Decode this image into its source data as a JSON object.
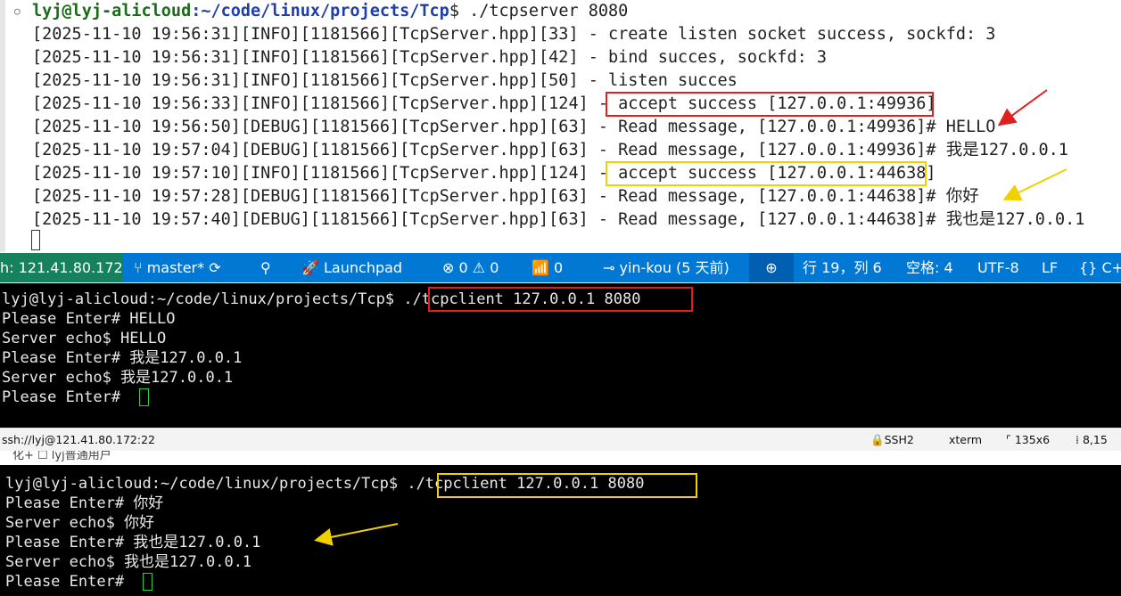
{
  "top_terminal": {
    "prompt_user": "lyj@lyj-alicloud",
    "prompt_path": ":~/code/linux/projects/Tcp",
    "prompt_cmd": "$ ./tcpserver 8080",
    "log_lines": [
      "[2025-11-10 19:56:31][INFO][1181566][TcpServer.hpp][33] - create listen socket success, sockfd: 3",
      "[2025-11-10 19:56:31][INFO][1181566][TcpServer.hpp][42] - bind succes, sockfd: 3",
      "[2025-11-10 19:56:31][INFO][1181566][TcpServer.hpp][50] - listen succes",
      "[2025-11-10 19:56:33][INFO][1181566][TcpServer.hpp][124] - accept success [127.0.0.1:49936]",
      "[2025-11-10 19:56:50][DEBUG][1181566][TcpServer.hpp][63] - Read message, [127.0.0.1:49936]# HELLO",
      "[2025-11-10 19:57:04][DEBUG][1181566][TcpServer.hpp][63] - Read message, [127.0.0.1:49936]# 我是127.0.0.1",
      "[2025-11-10 19:57:10][INFO][1181566][TcpServer.hpp][124] - accept success [127.0.0.1:44638]",
      "[2025-11-10 19:57:28][DEBUG][1181566][TcpServer.hpp][63] - Read message, [127.0.0.1:44638]# 你好",
      "[2025-11-10 19:57:40][DEBUG][1181566][TcpServer.hpp][63] - Read message, [127.0.0.1:44638]# 我也是127.0.0.1"
    ]
  },
  "status_bar": {
    "remote": "h: 121.41.80.172",
    "branch": "master*",
    "problems": "⊗ 0 ⚠ 0",
    "ports": "0",
    "launchpad": "Launchpad",
    "author": "yin-kou (5 天前)",
    "position": "行 19，列 6",
    "spaces": "空格: 4",
    "encoding": "UTF-8",
    "eol": "LF",
    "language": "{} C+"
  },
  "middle_terminal": {
    "lines": [
      "lyj@lyj-alicloud:~/code/linux/projects/Tcp$ ./tcpclient 127.0.0.1 8080",
      "Please Enter# HELLO",
      "Server echo$ HELLO",
      "Please Enter# 我是127.0.0.1",
      "Server echo$ 我是127.0.0.1",
      "Please Enter# "
    ]
  },
  "info_bar": {
    "session": "ssh://lyj@121.41.80.172:22",
    "protocol": "SSH2",
    "term": "xterm",
    "size": "135x6",
    "cursor_pos": "8,15"
  },
  "tab_strip": {
    "text": "化+ ☐ lyj普通用户"
  },
  "bottom_terminal": {
    "lines": [
      "lyj@lyj-alicloud:~/code/linux/projects/Tcp$ ./tcpclient 127.0.0.1 8080",
      "Please Enter# 你好",
      "Server echo$ 你好",
      "Please Enter# 我也是127.0.0.1",
      "Server echo$ 我也是127.0.0.1",
      "Please Enter# "
    ]
  },
  "colors": {
    "highlight_red": "#e02020",
    "highlight_yellow": "#f2d000",
    "status_blue": "#0078d4",
    "cursor_green": "#2ecc40"
  }
}
